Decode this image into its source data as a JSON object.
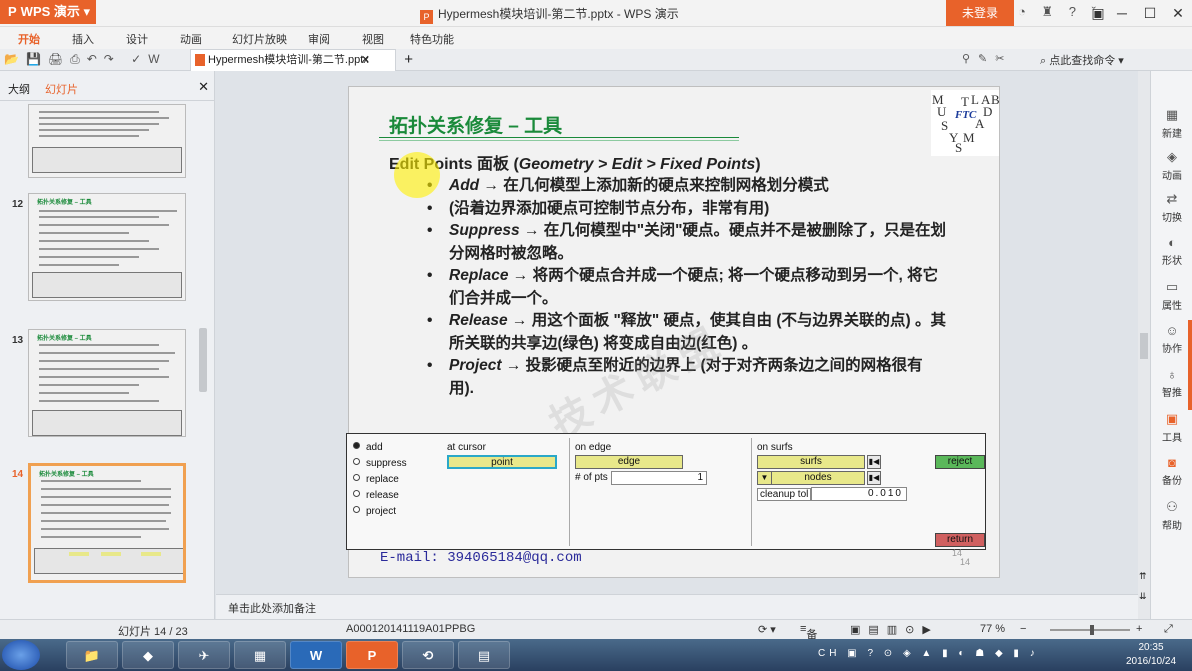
{
  "app": {
    "name": "WPS 演示",
    "doc_title": "Hypermesh模块培训-第二节.pptx - WPS 演示",
    "login": "未登录",
    "tab_title": "Hypermesh模块培训-第二节.pptx",
    "search_placeholder": "点此查找命令"
  },
  "menu": [
    "开始",
    "插入",
    "设计",
    "动画",
    "幻灯片放映",
    "审阅",
    "视图",
    "特色功能"
  ],
  "left_panel": {
    "tab_outline": "大纲",
    "tab_slides": "幻灯片",
    "thumbs": [
      {
        "num": "",
        "title": ""
      },
      {
        "num": "12",
        "title": "拓扑关系修复 – 工具"
      },
      {
        "num": "13",
        "title": "拓扑关系修复 – 工具"
      },
      {
        "num": "14",
        "title": "拓扑关系修复 – 工具"
      }
    ]
  },
  "slide": {
    "title": "拓扑关系修复 – 工具",
    "subtitle_a": "Edit Points 面板 (",
    "subtitle_b": "Geometry > Edit > Fixed Points",
    "subtitle_c": ")",
    "bullets": [
      {
        "key": "Add",
        "text": " → 在几何模型上添加新的硬点来控制网格划分模式"
      },
      {
        "key": "",
        "text": "(沿着边界添加硬点可控制节点分布，非常有用)"
      },
      {
        "key": "Suppress",
        "text": " → 在几何模型中\"关闭\"硬点。硬点并不是被删除了，只是在划分网格时被忽略。"
      },
      {
        "key": "Replace",
        "text": " → 将两个硬点合并成一个硬点; 将一个硬点移动到另一个, 将它们合并成一个。"
      },
      {
        "key": "Release",
        "text": " → 用这个面板 \"释放\" 硬点，使其自由 (不与边界关联的点) 。其所关联的共享边(绿色) 将变成自由边(红色) 。"
      },
      {
        "key": "Project",
        "text": " → 投影硬点至附近的边界上 (对于对齐两条边之间的网格很有用)."
      }
    ],
    "logo_letters": [
      "M",
      "T",
      "L",
      "A",
      "B",
      "U",
      "D",
      "FTC",
      "A",
      "S",
      "Y",
      "M",
      "S"
    ],
    "email": "E-mail: 394065184@qq.com",
    "page_num": "14",
    "page_num2": "14"
  },
  "hm_panel": {
    "radios": [
      "add",
      "suppress",
      "replace",
      "release",
      "project"
    ],
    "selected": "add",
    "at_cursor": "at cursor",
    "point": "point",
    "on_edge": "on edge",
    "edge": "edge",
    "num_pts_label": "# of pts",
    "num_pts_value": "1",
    "on_surfs": "on surfs",
    "surfs": "surfs",
    "nodes": "nodes",
    "cleanup_label": "cleanup tol",
    "cleanup_value": "0.010",
    "reject": "reject",
    "return": "return"
  },
  "notes": "单击此处添加备注",
  "status": {
    "slide_count": "幻灯片 14 / 23",
    "template_id": "A000120141119A01PPBG",
    "notes_btn": "备注",
    "zoom": "77 %"
  },
  "right_panel": [
    "新建",
    "动画",
    "切换",
    "形状",
    "属性",
    "协作",
    "智推",
    "工具",
    "备份",
    "帮助"
  ],
  "taskbar": {
    "time": "20:35",
    "date": "2016/10/24",
    "lang": "CH"
  },
  "watermark": "技术联盟",
  "colors": {
    "accent": "#e8622a",
    "slide_title": "#1a8a3a",
    "hm_yellow": "#e8e88a",
    "hm_green": "#5ab85a",
    "hm_red": "#d06060"
  }
}
